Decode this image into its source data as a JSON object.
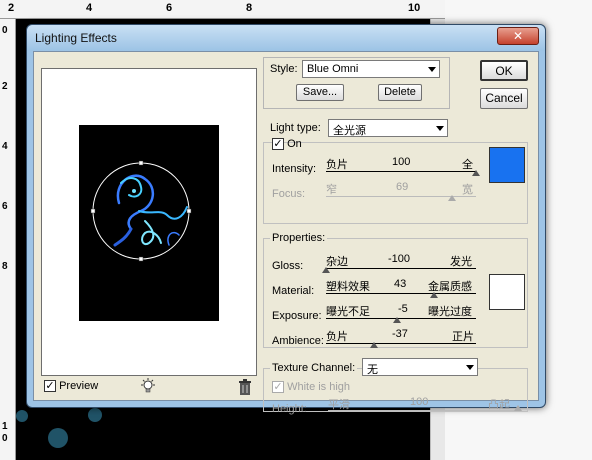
{
  "host": {
    "ruler_numbers": [
      "2",
      "4",
      "6",
      "8",
      "10"
    ],
    "ruler_left_numbers": [
      "0",
      "2",
      "4",
      "6",
      "8",
      "1",
      "0"
    ]
  },
  "dialog": {
    "title": "Lighting Effects",
    "close_label": "✕",
    "ok_label": "OK",
    "cancel_label": "Cancel"
  },
  "preview": {
    "label": "Preview",
    "checked": true
  },
  "style": {
    "label": "Style:",
    "value": "Blue Omni",
    "save_label": "Save...",
    "delete_label": "Delete"
  },
  "light": {
    "type_label": "Light type:",
    "type_value": "全光源",
    "on_label": "On",
    "on_checked": true,
    "intensity": {
      "label": "Intensity:",
      "left": "负片",
      "value": "100",
      "right": "全",
      "level": 1.0
    },
    "focus": {
      "label": "Focus:",
      "left": "窄",
      "value": "69",
      "right": "宽",
      "level": 0.84
    },
    "color": "#1872f0"
  },
  "properties": {
    "title": "Properties:",
    "gloss": {
      "label": "Gloss:",
      "left": "杂边",
      "value": "-100",
      "right": "发光",
      "level": 0.0
    },
    "material": {
      "label": "Material:",
      "left": "塑料效果",
      "value": "43",
      "right": "金属质感",
      "level": 0.72
    },
    "exposure": {
      "label": "Exposure:",
      "left": "曝光不足",
      "value": "-5",
      "right": "曝光过度",
      "level": 0.47
    },
    "ambience": {
      "label": "Ambience:",
      "left": "负片",
      "value": "-37",
      "right": "正片",
      "level": 0.32
    },
    "color": "#ffffff"
  },
  "texture": {
    "label": "Texture Channel:",
    "value": "无",
    "white_is_high_label": "White is high",
    "height": {
      "label": "Height:",
      "left": "平滑",
      "value": "100",
      "right": "凸起",
      "level": 1.0
    }
  }
}
